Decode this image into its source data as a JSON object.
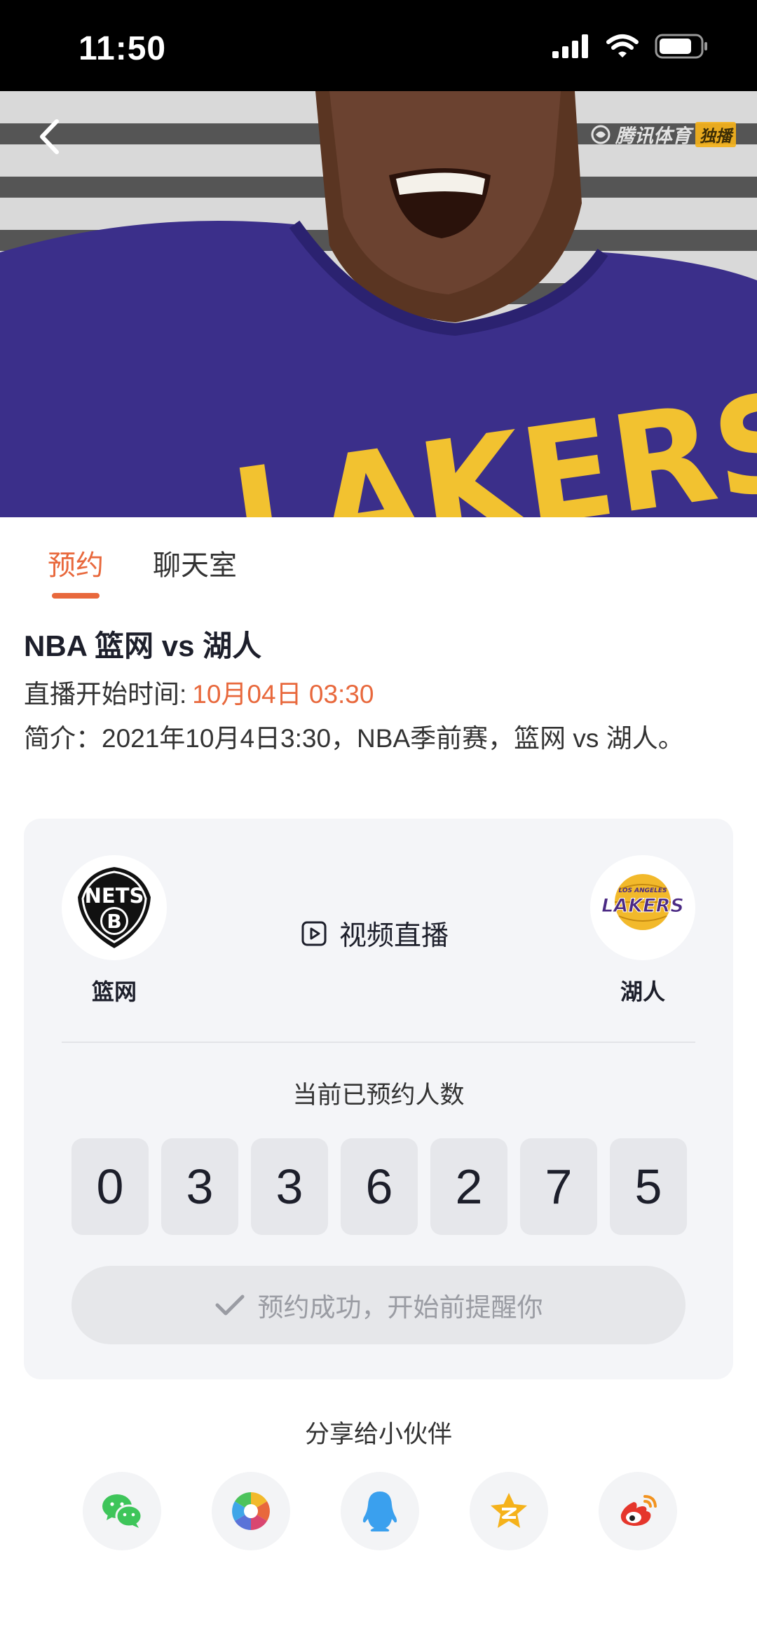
{
  "status_bar": {
    "time": "11:50"
  },
  "hero": {
    "brand": "腾讯体育",
    "brand_badge": "独播",
    "jersey_text": "LAKERS"
  },
  "tabs": [
    {
      "label": "预约",
      "active": true
    },
    {
      "label": "聊天室",
      "active": false
    }
  ],
  "match": {
    "title": "NBA 篮网 vs 湖人",
    "start_label": "直播开始时间:",
    "start_time": "10月04日  03:30",
    "intro": "简介：2021年10月4日3:30，NBA季前赛，篮网 vs 湖人。"
  },
  "card": {
    "home_team": {
      "name": "篮网",
      "logo_text": "NETS"
    },
    "away_team": {
      "name": "湖人",
      "logo_text": "LAKERS",
      "logo_small": "LOS ANGELES"
    },
    "live_type": "视频直播",
    "count_label": "当前已预约人数",
    "count_digits": [
      "0",
      "3",
      "3",
      "6",
      "2",
      "7",
      "5"
    ],
    "reserve_button": "预约成功，开始前提醒你"
  },
  "share": {
    "title": "分享给小伙伴",
    "targets": [
      "wechat-icon",
      "moments-icon",
      "qq-icon",
      "qzone-icon",
      "weibo-icon"
    ]
  },
  "colors": {
    "accent": "#e8683c",
    "card_bg": "#f4f5f8",
    "text": "#1d1f2b"
  }
}
